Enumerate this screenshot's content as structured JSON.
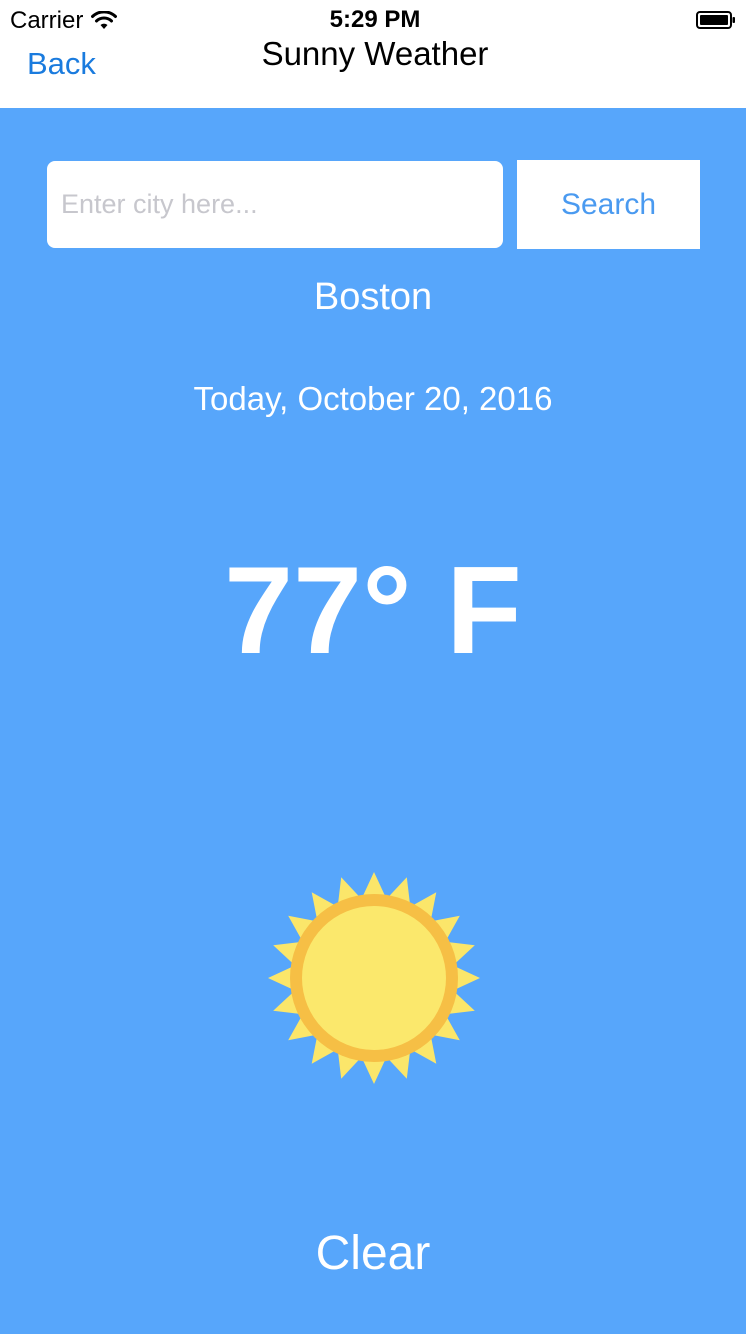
{
  "status_bar": {
    "carrier": "Carrier",
    "time": "5:29 PM",
    "icons": [
      "wifi-icon",
      "battery-icon"
    ]
  },
  "nav": {
    "back_label": "Back",
    "title": "Sunny Weather"
  },
  "search": {
    "placeholder": "Enter city here...",
    "value": "",
    "button_label": "Search"
  },
  "weather": {
    "city": "Boston",
    "date": "Today, October 20, 2016",
    "temperature": "77° F",
    "condition": "Clear",
    "icon": "sun-icon"
  },
  "colors": {
    "background": "#57a6fb",
    "accent": "#1a7bde",
    "sun_outer": "#f7c948",
    "sun_inner": "#fbe66a"
  }
}
